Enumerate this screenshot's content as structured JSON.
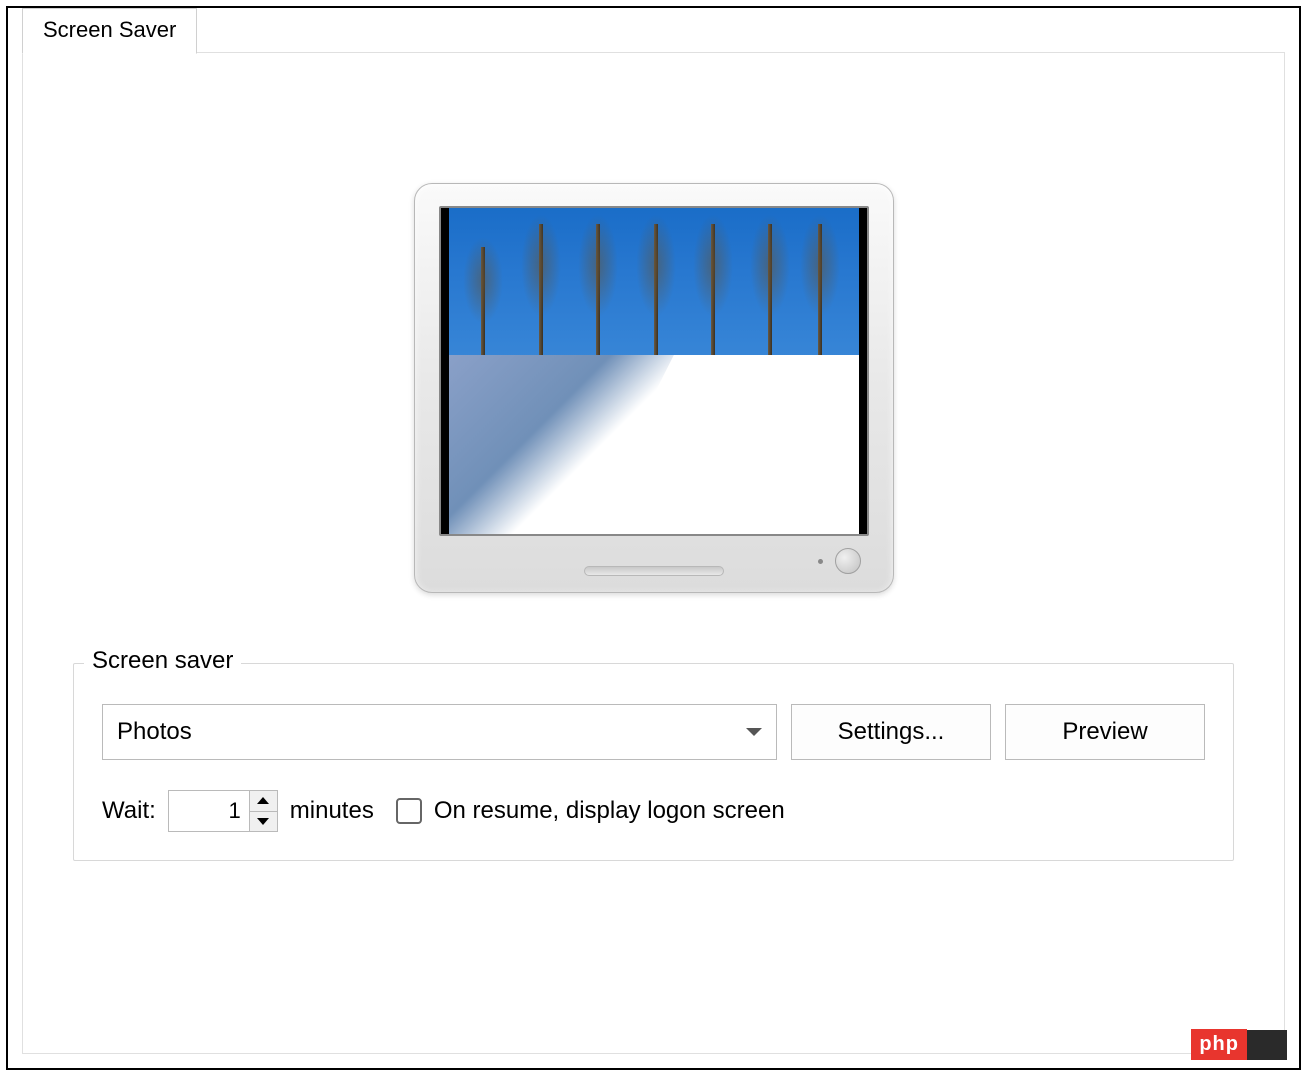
{
  "tab": {
    "label": "Screen Saver"
  },
  "group": {
    "label": "Screen saver",
    "dropdown_value": "Photos",
    "settings_label": "Settings...",
    "preview_label": "Preview",
    "wait_label": "Wait:",
    "wait_value": "1",
    "minutes_label": "minutes",
    "resume_label": "On resume, display logon screen"
  },
  "badge": {
    "text": "php"
  }
}
